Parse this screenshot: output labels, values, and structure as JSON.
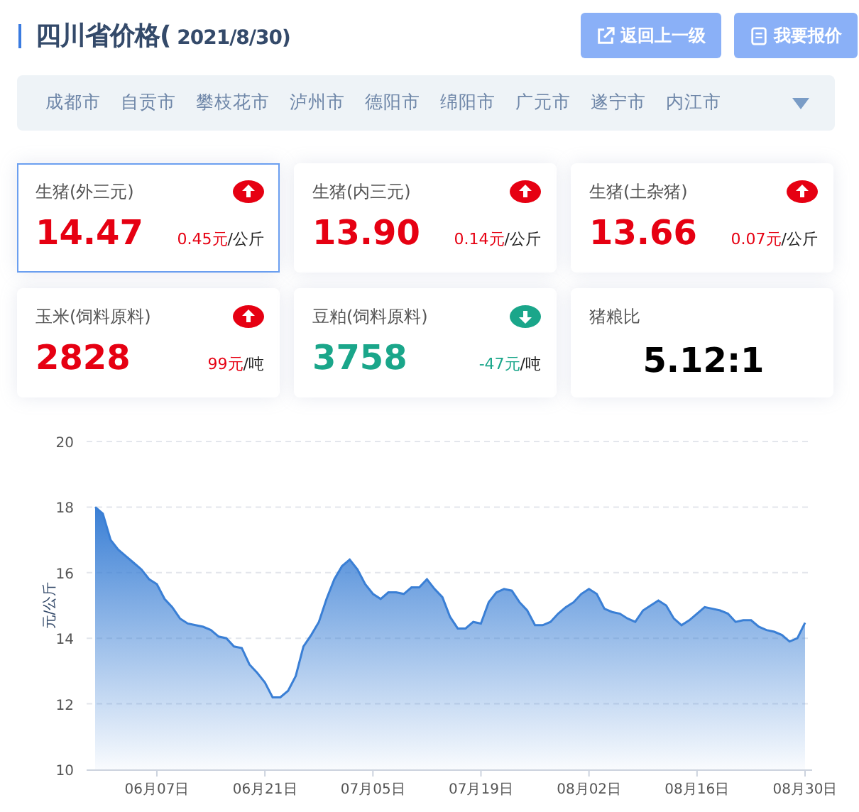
{
  "header": {
    "title": "四川省价格(",
    "date": " 2021/8/30)"
  },
  "buttons": [
    {
      "label": "返回上一级",
      "kind": "back"
    },
    {
      "label": "我要报价",
      "kind": "quote"
    }
  ],
  "cities": [
    {
      "label": "成都市"
    },
    {
      "label": "自贡市"
    },
    {
      "label": "攀枝花市"
    },
    {
      "label": "泸州市"
    },
    {
      "label": "德阳市"
    },
    {
      "label": "绵阳市"
    },
    {
      "label": "广元市"
    },
    {
      "label": "遂宁市"
    },
    {
      "label": "内江市"
    }
  ],
  "cards": [
    {
      "kind": "price",
      "name": "生猪(外三元)",
      "value": "14.47",
      "change": "0.45元",
      "unit": "/公斤",
      "rising": true,
      "selected": true
    },
    {
      "kind": "price",
      "name": "生猪(内三元)",
      "value": "13.90",
      "change": "0.14元",
      "unit": "/公斤",
      "rising": true,
      "selected": false
    },
    {
      "kind": "price",
      "name": "生猪(土杂猪)",
      "value": "13.66",
      "change": "0.07元",
      "unit": "/公斤",
      "rising": true,
      "selected": false
    },
    {
      "kind": "price",
      "name": "玉米(饲料原料)",
      "value": "2828",
      "change": "99元",
      "unit": "/吨",
      "rising": true,
      "selected": false
    },
    {
      "kind": "price",
      "name": "豆粕(饲料原料)",
      "value": "3758",
      "change": "-47元",
      "unit": "/吨",
      "rising": false,
      "selected": false
    },
    {
      "kind": "ratio",
      "name": "猪粮比",
      "value": "5.12:1",
      "selected": false
    }
  ],
  "chart": {
    "chart_data": {
      "type": "area",
      "ylabel": "元/公斤",
      "ylim": [
        10,
        20
      ],
      "yticks": [
        10,
        12,
        14,
        16,
        18,
        20
      ],
      "grid": true,
      "categories": [
        null,
        null,
        null,
        null,
        null,
        null,
        null,
        null,
        "06月07日",
        null,
        null,
        null,
        null,
        null,
        null,
        null,
        null,
        null,
        null,
        null,
        null,
        null,
        "06月21日",
        null,
        null,
        null,
        null,
        null,
        null,
        null,
        null,
        null,
        null,
        null,
        null,
        null,
        "07月05日",
        null,
        null,
        null,
        null,
        null,
        null,
        null,
        null,
        null,
        null,
        null,
        null,
        null,
        "07月19日",
        null,
        null,
        null,
        null,
        null,
        null,
        null,
        null,
        null,
        null,
        null,
        null,
        null,
        "08月02日",
        null,
        null,
        null,
        null,
        null,
        null,
        null,
        null,
        null,
        null,
        null,
        null,
        null,
        "08月16日",
        null,
        null,
        null,
        null,
        null,
        null,
        null,
        null,
        null,
        null,
        null,
        null,
        null,
        "08月30日"
      ],
      "series": [
        {
          "color": "#3a7fd5",
          "values": [
            18.0,
            17.8,
            17.0,
            16.7,
            16.5,
            16.3,
            16.1,
            15.8,
            15.65,
            15.2,
            14.95,
            14.6,
            14.45,
            14.4,
            14.35,
            14.25,
            14.05,
            14.0,
            13.75,
            13.7,
            13.2,
            12.95,
            12.65,
            12.2,
            12.2,
            12.4,
            12.85,
            13.75,
            14.1,
            14.5,
            15.2,
            15.8,
            16.2,
            16.4,
            16.1,
            15.65,
            15.35,
            15.2,
            15.4,
            15.4,
            15.35,
            15.55,
            15.55,
            15.8,
            15.5,
            15.25,
            14.65,
            14.3,
            14.3,
            14.5,
            14.45,
            15.1,
            15.4,
            15.5,
            15.45,
            15.1,
            14.85,
            14.4,
            14.4,
            14.5,
            14.75,
            14.95,
            15.1,
            15.35,
            15.5,
            15.35,
            14.9,
            14.8,
            14.75,
            14.6,
            14.5,
            14.85,
            15.0,
            15.15,
            15.0,
            14.6,
            14.4,
            14.55,
            14.75,
            14.95,
            14.9,
            14.85,
            14.75,
            14.5,
            14.55,
            14.55,
            14.35,
            14.25,
            14.2,
            14.1,
            13.9,
            14.0,
            14.47
          ]
        }
      ]
    }
  }
}
